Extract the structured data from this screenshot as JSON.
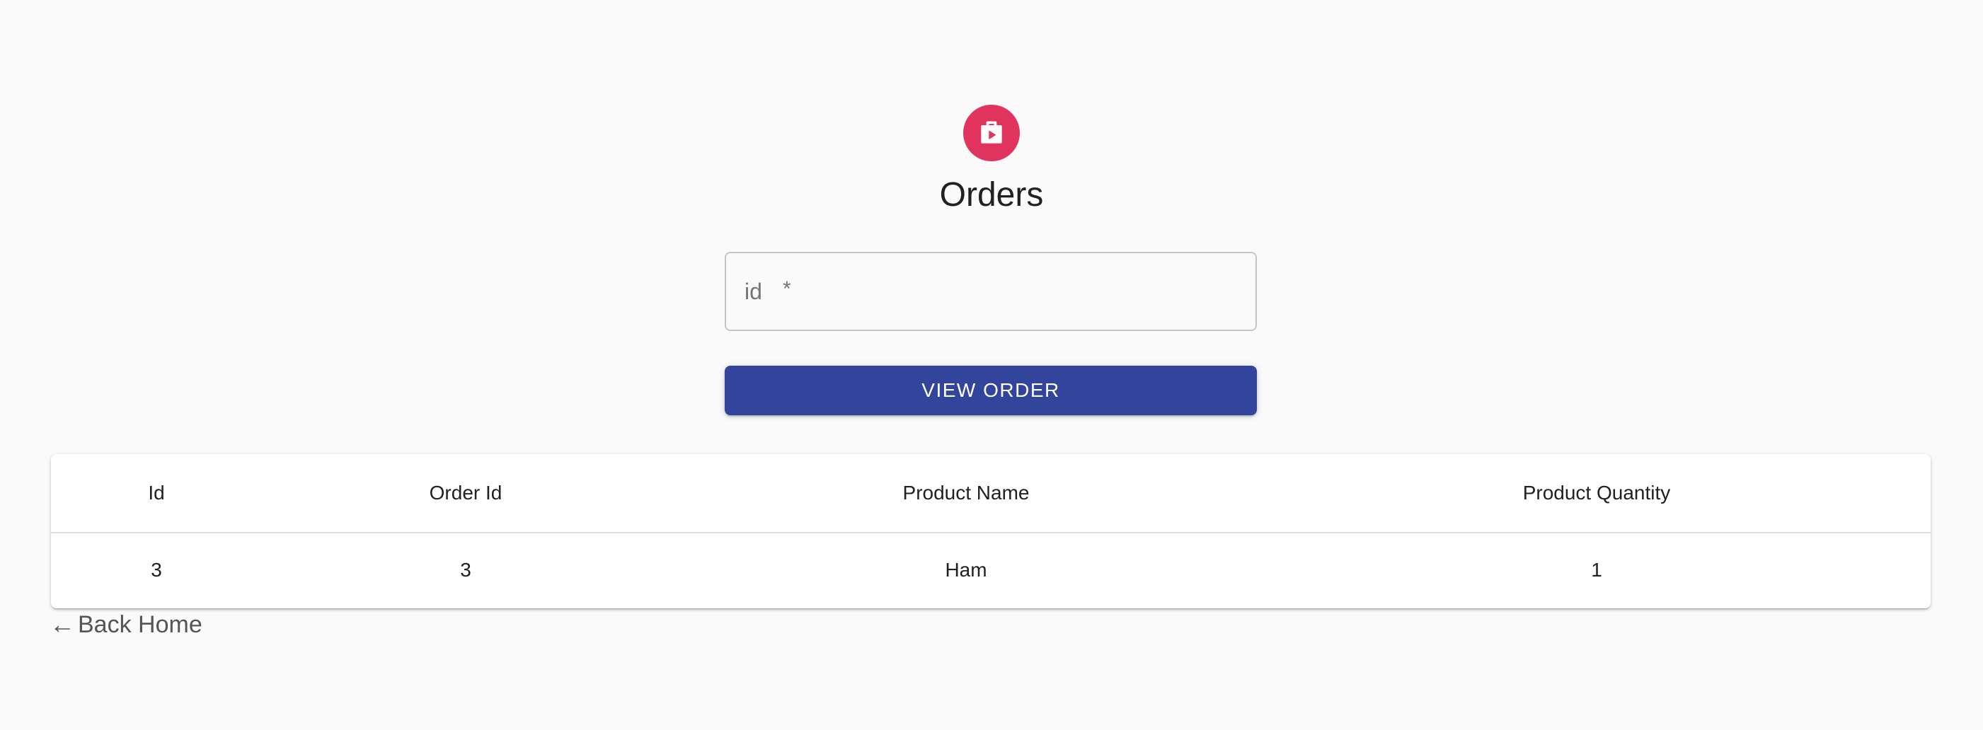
{
  "header": {
    "icon": "shopping-bag-icon",
    "icon_color": "#e0345e",
    "title": "Orders"
  },
  "form": {
    "id_placeholder": "id",
    "id_required_marker": "*",
    "id_value": "",
    "submit_label": "VIEW ORDER",
    "submit_color": "#33449c"
  },
  "table": {
    "columns": [
      "Id",
      "Order Id",
      "Product Name",
      "Product Quantity"
    ],
    "rows": [
      [
        "3",
        "3",
        "Ham",
        "1"
      ]
    ]
  },
  "footer": {
    "back_arrow": "←",
    "back_label": "Back Home"
  }
}
